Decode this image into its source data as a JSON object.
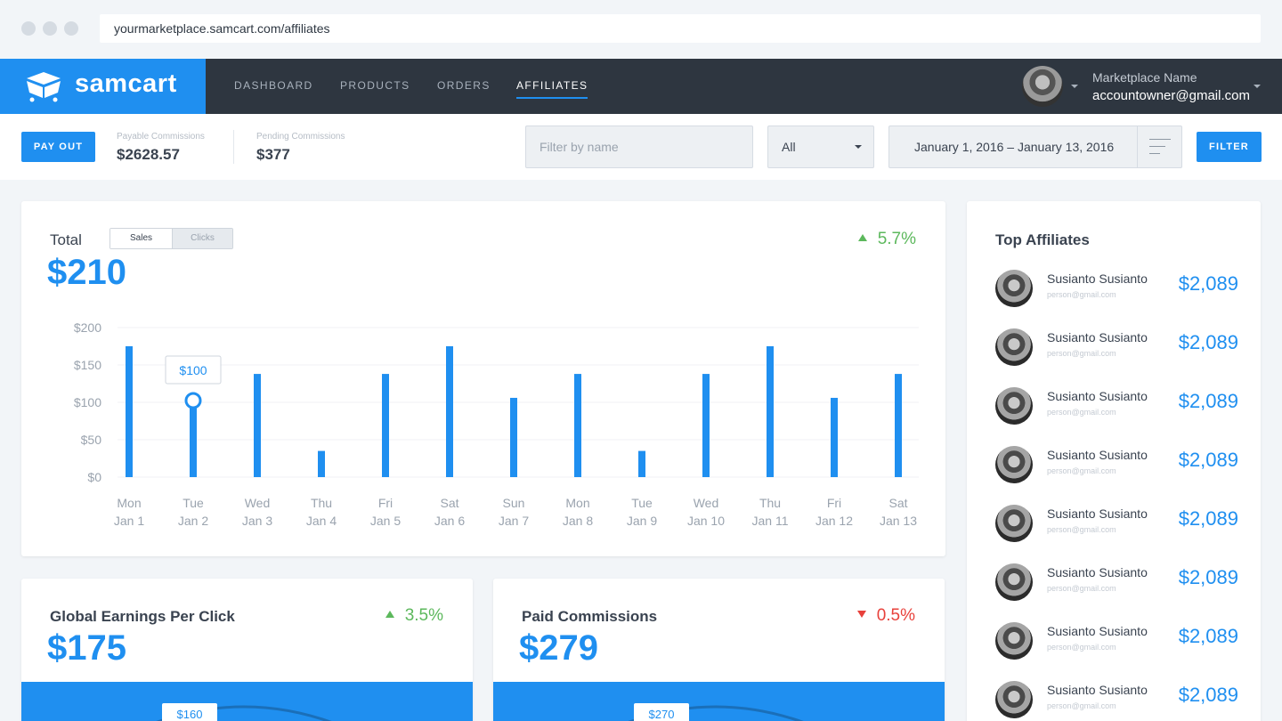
{
  "browser": {
    "url": "yourmarketplace.samcart.com/affiliates"
  },
  "brand": {
    "name": "samcart",
    "accent": "#1f8ff0",
    "nav_bg": "#2e3640",
    "up_color": "#5cb85c",
    "down_color": "#e8413b"
  },
  "nav": {
    "items": [
      {
        "label": "DASHBOARD",
        "active": false
      },
      {
        "label": "PRODUCTS",
        "active": false
      },
      {
        "label": "ORDERS",
        "active": false
      },
      {
        "label": "AFFILIATES",
        "active": true
      }
    ],
    "account": {
      "name": "Marketplace Name",
      "email": "accountowner@gmail.com"
    }
  },
  "filters": {
    "payout_label": "PAY OUT",
    "payable": {
      "label": "Payable Commissions",
      "value": "$2628.57"
    },
    "pending": {
      "label": "Pending Commissions",
      "value": "$377"
    },
    "name_placeholder": "Filter by name",
    "status_selected": "All",
    "date_range": "January 1, 2016 – January 13, 2016",
    "filter_label": "FILTER"
  },
  "total_card": {
    "title": "Total",
    "toggle": {
      "sales": "Sales",
      "clicks": "Clicks"
    },
    "value": "$210",
    "delta": "5.7%",
    "tooltip": "$100"
  },
  "chart_data": {
    "type": "bar",
    "categories": [
      "Mon Jan 1",
      "Tue Jan 2",
      "Wed Jan 3",
      "Thu Jan 4",
      "Fri Jan 5",
      "Sat Jan 6",
      "Sun Jan 7",
      "Mon Jan 8",
      "Tue Jan 9",
      "Wed Jan 10",
      "Thu Jan 11",
      "Fri Jan 12",
      "Sat Jan 13"
    ],
    "x_day": [
      "Mon",
      "Tue",
      "Wed",
      "Thu",
      "Fri",
      "Sat",
      "Sun",
      "Mon",
      "Tue",
      "Wed",
      "Thu",
      "Fri",
      "Sat"
    ],
    "x_date": [
      "Jan 1",
      "Jan 2",
      "Jan 3",
      "Jan 4",
      "Jan 5",
      "Jan 6",
      "Jan 7",
      "Jan 8",
      "Jan 9",
      "Jan 10",
      "Jan 11",
      "Jan 12",
      "Jan 13"
    ],
    "values": [
      175,
      100,
      138,
      35,
      138,
      175,
      106,
      138,
      35,
      138,
      175,
      106,
      138
    ],
    "ylim": [
      0,
      200
    ],
    "yticks": [
      0,
      50,
      100,
      150,
      200
    ],
    "ytick_labels": [
      "$0",
      "$50",
      "$100",
      "$150",
      "$200"
    ],
    "highlight_index": 1,
    "grid": true
  },
  "epc_card": {
    "title": "Global Earnings Per Click",
    "value": "$175",
    "delta": "3.5%",
    "tooltip": "$160"
  },
  "paid_card": {
    "title": "Paid Commissions",
    "value": "$279",
    "delta": "0.5%",
    "tooltip": "$270"
  },
  "top_affiliates": {
    "title": "Top Affiliates",
    "items": [
      {
        "name": "Susianto Susianto",
        "email": "person@gmail.com",
        "amount": "$2,089"
      },
      {
        "name": "Susianto Susianto",
        "email": "person@gmail.com",
        "amount": "$2,089"
      },
      {
        "name": "Susianto Susianto",
        "email": "person@gmail.com",
        "amount": "$2,089"
      },
      {
        "name": "Susianto Susianto",
        "email": "person@gmail.com",
        "amount": "$2,089"
      },
      {
        "name": "Susianto Susianto",
        "email": "person@gmail.com",
        "amount": "$2,089"
      },
      {
        "name": "Susianto Susianto",
        "email": "person@gmail.com",
        "amount": "$2,089"
      },
      {
        "name": "Susianto Susianto",
        "email": "person@gmail.com",
        "amount": "$2,089"
      },
      {
        "name": "Susianto Susianto",
        "email": "person@gmail.com",
        "amount": "$2,089"
      }
    ]
  }
}
